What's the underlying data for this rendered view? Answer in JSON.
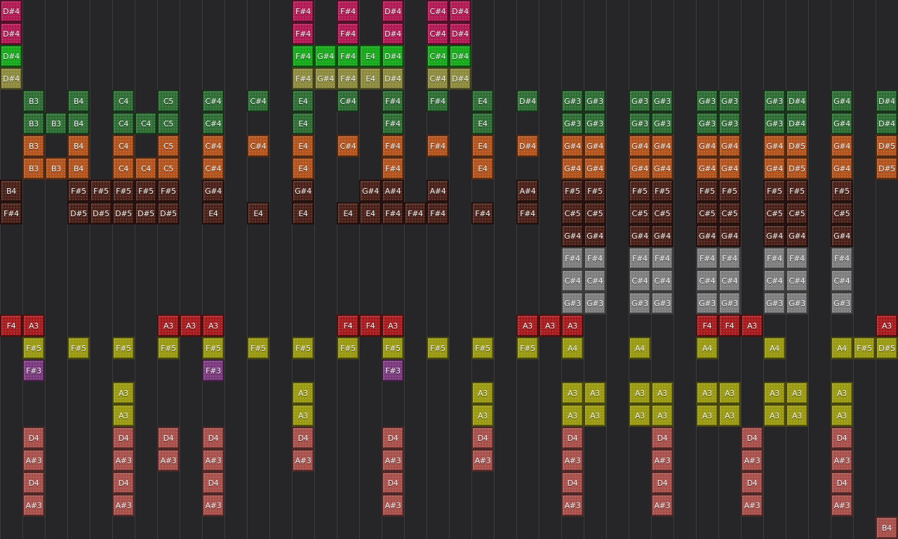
{
  "palette": {
    "background": "#262628",
    "grid_line": "#3a3a3d",
    "magenta": "#b21a56",
    "green": "#17a81b",
    "olive": "#8d8b3e",
    "dark_green": "#2e6e35",
    "orange": "#b3541e",
    "brown": "#4a2119",
    "silver": "#7e7e7e",
    "red": "#a51b1e",
    "yellow": "#9a9a12",
    "purple": "#7c3a7e",
    "pink": "#a8504b"
  },
  "rows": [
    {
      "color": "magenta",
      "notes": [
        [
          0,
          "D#4"
        ],
        [
          13,
          "F#4"
        ],
        [
          15,
          "F#4"
        ],
        [
          17,
          "D#4"
        ],
        [
          19,
          "C#4"
        ],
        [
          20,
          "D#4"
        ]
      ]
    },
    {
      "color": "magenta",
      "notes": [
        [
          0,
          "D#4"
        ],
        [
          13,
          "F#4"
        ],
        [
          15,
          "F#4"
        ],
        [
          17,
          "D#4"
        ],
        [
          19,
          "C#4"
        ],
        [
          20,
          "D#4"
        ]
      ]
    },
    {
      "color": "green",
      "notes": [
        [
          0,
          "D#4"
        ],
        [
          13,
          "F#4"
        ],
        [
          14,
          "G#4"
        ],
        [
          15,
          "F#4"
        ],
        [
          16,
          "E4"
        ],
        [
          17,
          "D#4"
        ],
        [
          19,
          "C#4"
        ],
        [
          20,
          "D#4"
        ]
      ]
    },
    {
      "color": "olive",
      "notes": [
        [
          0,
          "D#4"
        ],
        [
          13,
          "F#4"
        ],
        [
          14,
          "G#4"
        ],
        [
          15,
          "F#4"
        ],
        [
          16,
          "E4"
        ],
        [
          17,
          "D#4"
        ],
        [
          19,
          "C#4"
        ],
        [
          20,
          "D#4"
        ]
      ]
    },
    {
      "color": "dark_green",
      "notes": [
        [
          1,
          "B3"
        ],
        [
          3,
          "B4"
        ],
        [
          5,
          "C4"
        ],
        [
          7,
          "C5"
        ],
        [
          9,
          "C#4"
        ],
        [
          11,
          "C#4"
        ],
        [
          13,
          "E4"
        ],
        [
          15,
          "C#4"
        ],
        [
          17,
          "F#4"
        ],
        [
          19,
          "F#4"
        ],
        [
          21,
          "E4"
        ],
        [
          23,
          "D#4"
        ],
        [
          25,
          "G#3"
        ],
        [
          26,
          "G#3"
        ],
        [
          28,
          "G#3"
        ],
        [
          29,
          "G#3"
        ],
        [
          31,
          "G#3"
        ],
        [
          32,
          "G#3"
        ],
        [
          34,
          "G#3"
        ],
        [
          35,
          "D#4"
        ],
        [
          37,
          "G#4"
        ],
        [
          39,
          "D#4"
        ]
      ]
    },
    {
      "color": "dark_green",
      "notes": [
        [
          1,
          "B3"
        ],
        [
          2,
          "B3"
        ],
        [
          3,
          "B4"
        ],
        [
          5,
          "C4"
        ],
        [
          6,
          "C4"
        ],
        [
          7,
          "C5"
        ],
        [
          9,
          "C#4"
        ],
        [
          13,
          "E4"
        ],
        [
          17,
          "F#4"
        ],
        [
          21,
          "E4"
        ],
        [
          25,
          "G#3"
        ],
        [
          26,
          "G#3"
        ],
        [
          28,
          "G#3"
        ],
        [
          29,
          "G#3"
        ],
        [
          31,
          "G#3"
        ],
        [
          32,
          "G#3"
        ],
        [
          34,
          "G#3"
        ],
        [
          35,
          "D#4"
        ],
        [
          37,
          "G#4"
        ],
        [
          39,
          "D#4"
        ]
      ]
    },
    {
      "color": "orange",
      "notes": [
        [
          1,
          "B3"
        ],
        [
          3,
          "B4"
        ],
        [
          5,
          "C4"
        ],
        [
          7,
          "C5"
        ],
        [
          9,
          "C#4"
        ],
        [
          11,
          "C#4"
        ],
        [
          13,
          "E4"
        ],
        [
          15,
          "C#4"
        ],
        [
          17,
          "F#4"
        ],
        [
          19,
          "F#4"
        ],
        [
          21,
          "E4"
        ],
        [
          23,
          "D#4"
        ],
        [
          25,
          "G#4"
        ],
        [
          26,
          "G#4"
        ],
        [
          28,
          "G#4"
        ],
        [
          29,
          "G#4"
        ],
        [
          31,
          "G#4"
        ],
        [
          32,
          "G#4"
        ],
        [
          34,
          "G#4"
        ],
        [
          35,
          "D#5"
        ],
        [
          37,
          "G#4"
        ],
        [
          39,
          "D#5"
        ]
      ]
    },
    {
      "color": "orange",
      "notes": [
        [
          1,
          "B3"
        ],
        [
          2,
          "B3"
        ],
        [
          3,
          "B4"
        ],
        [
          5,
          "C4"
        ],
        [
          6,
          "C4"
        ],
        [
          7,
          "C5"
        ],
        [
          9,
          "C#4"
        ],
        [
          13,
          "E4"
        ],
        [
          17,
          "F#4"
        ],
        [
          21,
          "E4"
        ],
        [
          25,
          "G#4"
        ],
        [
          26,
          "G#4"
        ],
        [
          28,
          "G#4"
        ],
        [
          29,
          "G#4"
        ],
        [
          31,
          "G#4"
        ],
        [
          32,
          "G#4"
        ],
        [
          34,
          "G#4"
        ],
        [
          35,
          "D#5"
        ],
        [
          37,
          "G#4"
        ],
        [
          39,
          "D#5"
        ]
      ]
    },
    {
      "color": "brown",
      "notes": [
        [
          0,
          "B4"
        ],
        [
          3,
          "F#5"
        ],
        [
          4,
          "F#5"
        ],
        [
          5,
          "F#5"
        ],
        [
          6,
          "F#5"
        ],
        [
          7,
          "F#5"
        ],
        [
          9,
          "G#4"
        ],
        [
          13,
          "G#4"
        ],
        [
          16,
          "G#4"
        ],
        [
          17,
          "A#4"
        ],
        [
          19,
          "A#4"
        ],
        [
          23,
          "A#4"
        ],
        [
          25,
          "F#5"
        ],
        [
          26,
          "F#5"
        ],
        [
          28,
          "F#5"
        ],
        [
          29,
          "F#5"
        ],
        [
          31,
          "F#5"
        ],
        [
          32,
          "F#5"
        ],
        [
          34,
          "F#5"
        ],
        [
          35,
          "F#5"
        ],
        [
          37,
          "F#5"
        ]
      ]
    },
    {
      "color": "brown",
      "notes": [
        [
          0,
          "F#4"
        ],
        [
          3,
          "D#5"
        ],
        [
          4,
          "D#5"
        ],
        [
          5,
          "D#5"
        ],
        [
          6,
          "D#5"
        ],
        [
          7,
          "D#5"
        ],
        [
          9,
          "E4"
        ],
        [
          11,
          "E4"
        ],
        [
          13,
          "E4"
        ],
        [
          15,
          "E4"
        ],
        [
          16,
          "E4"
        ],
        [
          17,
          "F#4"
        ],
        [
          18,
          "F#4"
        ],
        [
          19,
          "F#4"
        ],
        [
          21,
          "F#4"
        ],
        [
          23,
          "F#4"
        ],
        [
          25,
          "C#5"
        ],
        [
          26,
          "C#5"
        ],
        [
          28,
          "C#5"
        ],
        [
          29,
          "C#5"
        ],
        [
          31,
          "C#5"
        ],
        [
          32,
          "C#5"
        ],
        [
          34,
          "C#5"
        ],
        [
          35,
          "C#5"
        ],
        [
          37,
          "C#5"
        ]
      ]
    },
    {
      "color": "brown",
      "notes": [
        [
          25,
          "G#4"
        ],
        [
          26,
          "G#4"
        ],
        [
          28,
          "G#4"
        ],
        [
          29,
          "G#4"
        ],
        [
          31,
          "G#4"
        ],
        [
          32,
          "G#4"
        ],
        [
          34,
          "G#4"
        ],
        [
          35,
          "G#4"
        ],
        [
          37,
          "G#4"
        ]
      ]
    },
    {
      "color": "silver",
      "notes": [
        [
          25,
          "F#4"
        ],
        [
          26,
          "F#4"
        ],
        [
          28,
          "F#4"
        ],
        [
          29,
          "F#4"
        ],
        [
          31,
          "F#4"
        ],
        [
          32,
          "F#4"
        ],
        [
          34,
          "F#4"
        ],
        [
          35,
          "F#4"
        ],
        [
          37,
          "F#4"
        ]
      ]
    },
    {
      "color": "silver",
      "notes": [
        [
          25,
          "C#4"
        ],
        [
          26,
          "C#4"
        ],
        [
          28,
          "C#4"
        ],
        [
          29,
          "C#4"
        ],
        [
          31,
          "C#4"
        ],
        [
          32,
          "C#4"
        ],
        [
          34,
          "C#4"
        ],
        [
          35,
          "C#4"
        ],
        [
          37,
          "C#4"
        ]
      ]
    },
    {
      "color": "silver",
      "notes": [
        [
          25,
          "G#3"
        ],
        [
          26,
          "G#3"
        ],
        [
          28,
          "G#3"
        ],
        [
          29,
          "G#3"
        ],
        [
          31,
          "G#3"
        ],
        [
          32,
          "G#3"
        ],
        [
          34,
          "G#3"
        ],
        [
          35,
          "G#3"
        ],
        [
          37,
          "G#3"
        ]
      ]
    },
    {
      "color": "red",
      "notes": [
        [
          0,
          "F4"
        ],
        [
          1,
          "A3"
        ],
        [
          7,
          "A3"
        ],
        [
          8,
          "A3"
        ],
        [
          9,
          "A3"
        ],
        [
          15,
          "F4"
        ],
        [
          16,
          "F4"
        ],
        [
          17,
          "A3"
        ],
        [
          23,
          "A3"
        ],
        [
          24,
          "A3"
        ],
        [
          25,
          "A3"
        ],
        [
          31,
          "F4"
        ],
        [
          32,
          "F4"
        ],
        [
          33,
          "A3"
        ],
        [
          39,
          "A3"
        ]
      ]
    },
    {
      "color": "yellow",
      "notes": [
        [
          1,
          "F#5"
        ],
        [
          3,
          "F#5"
        ],
        [
          5,
          "F#5"
        ],
        [
          7,
          "F#5"
        ],
        [
          9,
          "F#5"
        ],
        [
          11,
          "F#5"
        ],
        [
          13,
          "F#5"
        ],
        [
          15,
          "F#5"
        ],
        [
          17,
          "F#5"
        ],
        [
          19,
          "F#5"
        ],
        [
          21,
          "F#5"
        ],
        [
          23,
          "F#5"
        ],
        [
          25,
          "A4"
        ],
        [
          28,
          "A4"
        ],
        [
          31,
          "A4"
        ],
        [
          34,
          "A4"
        ],
        [
          37,
          "A4"
        ],
        [
          38,
          "F#5"
        ],
        [
          39,
          "D#5"
        ]
      ]
    },
    {
      "color": "purple",
      "notes": [
        [
          1,
          "F#3"
        ],
        [
          9,
          "F#3"
        ],
        [
          17,
          "F#3"
        ]
      ]
    },
    {
      "color": "yellow",
      "notes": [
        [
          5,
          "A3"
        ],
        [
          13,
          "A3"
        ],
        [
          21,
          "A3"
        ],
        [
          25,
          "A3"
        ],
        [
          26,
          "A3"
        ],
        [
          28,
          "A3"
        ],
        [
          29,
          "A3"
        ],
        [
          31,
          "A3"
        ],
        [
          32,
          "A3"
        ],
        [
          34,
          "A3"
        ],
        [
          35,
          "A3"
        ],
        [
          37,
          "A3"
        ]
      ]
    },
    {
      "color": "yellow",
      "notes": [
        [
          5,
          "A3"
        ],
        [
          13,
          "A3"
        ],
        [
          21,
          "A3"
        ],
        [
          25,
          "A3"
        ],
        [
          26,
          "A3"
        ],
        [
          28,
          "A3"
        ],
        [
          29,
          "A3"
        ],
        [
          31,
          "A3"
        ],
        [
          32,
          "A3"
        ],
        [
          34,
          "A3"
        ],
        [
          35,
          "A3"
        ],
        [
          37,
          "A3"
        ]
      ]
    },
    {
      "color": "pink",
      "notes": [
        [
          1,
          "D4"
        ],
        [
          5,
          "D4"
        ],
        [
          7,
          "D4"
        ],
        [
          9,
          "D4"
        ],
        [
          13,
          "D4"
        ],
        [
          17,
          "D4"
        ],
        [
          21,
          "D4"
        ],
        [
          25,
          "D4"
        ],
        [
          29,
          "D4"
        ],
        [
          33,
          "D4"
        ],
        [
          37,
          "D4"
        ]
      ]
    },
    {
      "color": "pink",
      "notes": [
        [
          1,
          "A#3"
        ],
        [
          5,
          "A#3"
        ],
        [
          7,
          "A#3"
        ],
        [
          9,
          "A#3"
        ],
        [
          13,
          "A#3"
        ],
        [
          17,
          "A#3"
        ],
        [
          21,
          "A#3"
        ],
        [
          25,
          "A#3"
        ],
        [
          29,
          "A#3"
        ],
        [
          33,
          "A#3"
        ],
        [
          37,
          "A#3"
        ]
      ]
    },
    {
      "color": "pink",
      "notes": [
        [
          1,
          "D4"
        ],
        [
          5,
          "D4"
        ],
        [
          9,
          "D4"
        ],
        [
          17,
          "D4"
        ],
        [
          25,
          "D4"
        ],
        [
          29,
          "D4"
        ],
        [
          33,
          "D4"
        ],
        [
          37,
          "D4"
        ]
      ]
    },
    {
      "color": "pink",
      "notes": [
        [
          1,
          "A#3"
        ],
        [
          5,
          "A#3"
        ],
        [
          9,
          "A#3"
        ],
        [
          17,
          "A#3"
        ],
        [
          25,
          "A#3"
        ],
        [
          29,
          "A#3"
        ],
        [
          33,
          "A#3"
        ],
        [
          37,
          "A#3"
        ]
      ]
    },
    {
      "color": "pink",
      "notes": [
        [
          39,
          "B4"
        ]
      ]
    }
  ]
}
